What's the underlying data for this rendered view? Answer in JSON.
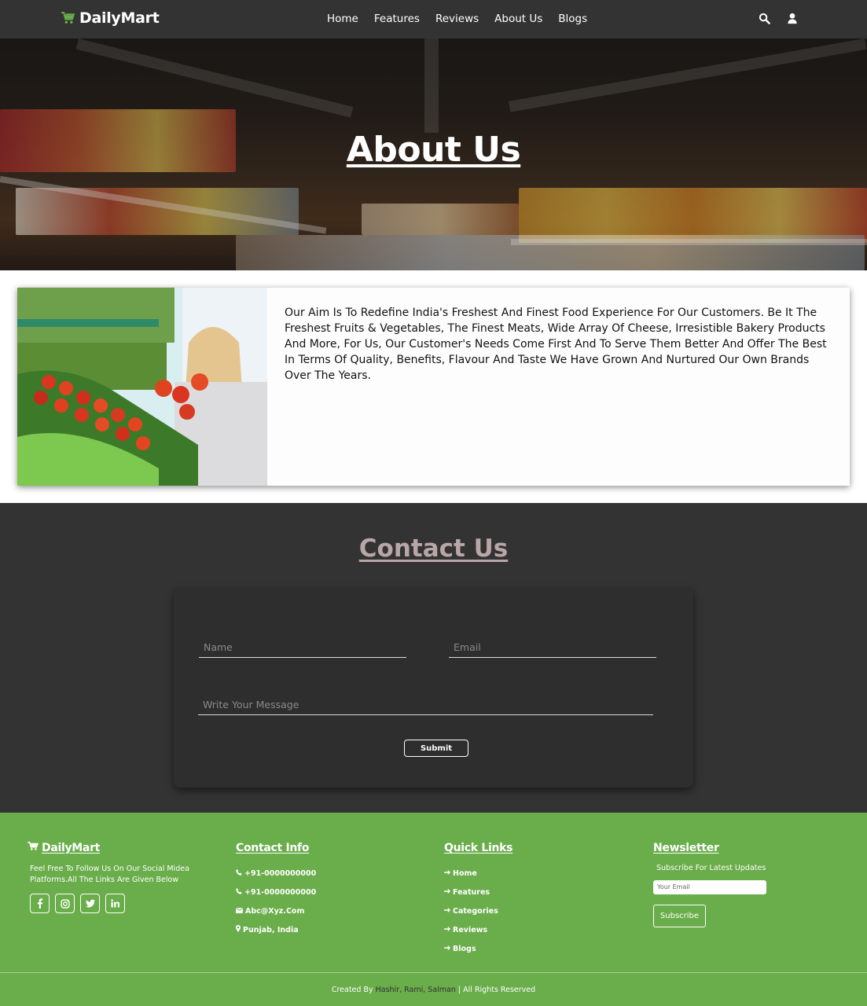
{
  "header": {
    "brand": "DailyMart",
    "nav": [
      "Home",
      "Features",
      "Reviews",
      "About Us",
      "Blogs"
    ]
  },
  "hero": {
    "title": "About Us"
  },
  "about": {
    "text": "Our Aim Is To Redefine India's Freshest And Finest Food Experience For Our Customers. Be It The Freshest Fruits & Vegetables, The Finest Meats, Wide Array Of Cheese, Irresistible Bakery Products And More, For Us, Our Customer's Needs Come First And To Serve Them Better And Offer The Best In Terms Of Quality, Benefits, Flavour And Taste We Have Grown And Nurtured Our Own Brands Over The Years."
  },
  "contact": {
    "title": "Contact Us",
    "name_placeholder": "Name",
    "email_placeholder": "Email",
    "message_placeholder": "Write Your Message",
    "submit_label": "Submit"
  },
  "footer": {
    "brand": "DailyMart",
    "description": "Feel Free To Follow Us On Our Social Midea Platforms.All The Links Are Given Below",
    "contact_title": "Contact Info",
    "phone1": "+91-0000000000",
    "phone2": "+91-0000000000",
    "email": "Abc@Xyz.Com",
    "location": "Punjab, India",
    "links_title": "Quick Links",
    "links": [
      "Home",
      "Features",
      "Categories",
      "Reviews",
      "Blogs"
    ],
    "newsletter_title": "Newsletter",
    "newsletter_label": "Subscribe For Latest Updates",
    "newsletter_placeholder": "Your Email",
    "subscribe_label": "Subscribe",
    "credit_prefix": "Created By",
    "credit_names": "Hashir, Rami, Salman",
    "credit_suffix": "| All Rights Reserved"
  },
  "colors": {
    "header_bg": "#333333",
    "brand_green": "#6aad4b",
    "contact_title": "#b9a6a6"
  },
  "icons": [
    "cart-icon",
    "search-icon",
    "user-icon",
    "facebook-icon",
    "instagram-icon",
    "twitter-icon",
    "linkedin-icon",
    "phone-icon",
    "envelope-icon",
    "map-marker-icon",
    "arrow-right-icon"
  ]
}
